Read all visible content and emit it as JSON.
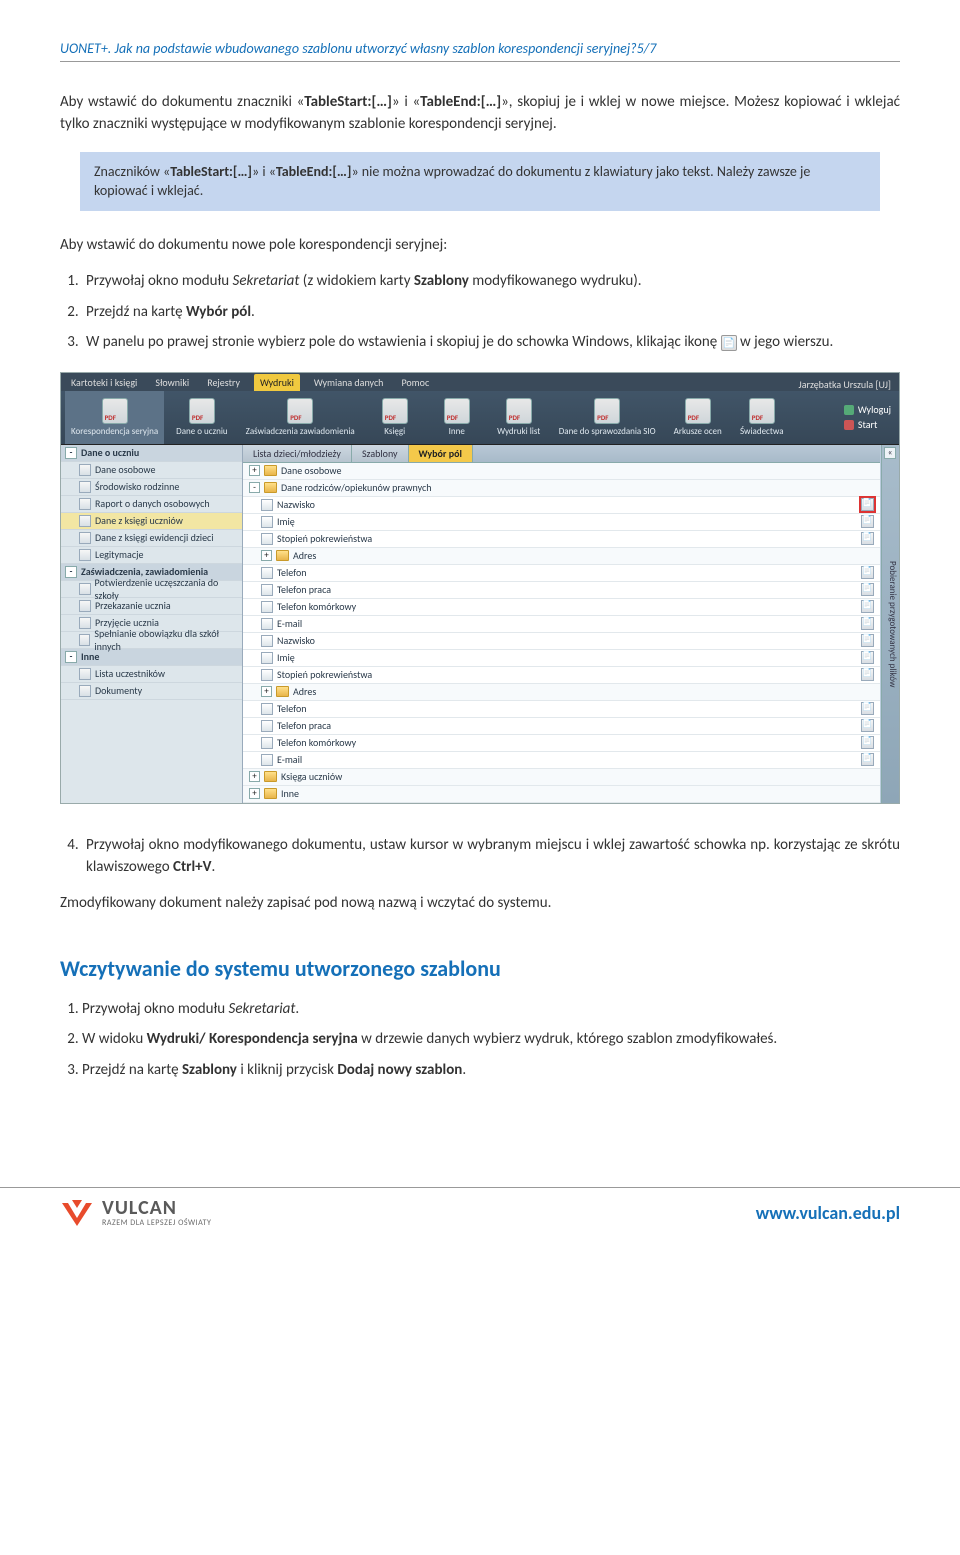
{
  "header": {
    "title": "UONET+. Jak na podstawie wbudowanego szablonu utworzyć własny szablon korespondencji seryjnej?5/7"
  },
  "para1_a": "Aby wstawić do dokumentu znaczniki «",
  "para1_ts": "TableStart:[…]",
  "para1_b": "» i «",
  "para1_te": "TableEnd:[…]",
  "para1_c": "», skopiuj je i wklej w nowe miejsce. Możesz kopiować i wklejać tylko znaczniki występujące w modyfikowanym szablonie korespondencji seryjnej.",
  "callout_a": "Znaczników «",
  "callout_ts": "TableStart:[…]",
  "callout_b": "» i «",
  "callout_te": "TableEnd:[…]",
  "callout_c": "» nie można wprowadzać do dokumentu z klawiatury jako tekst. Należy zawsze je kopiować i wklejać.",
  "para2": "Aby wstawić do dokumentu nowe pole korespondencji seryjnej:",
  "step1_a": "Przywołaj okno modułu ",
  "step1_b": "Sekretariat",
  "step1_c": " (z widokiem karty ",
  "step1_d": "Szablony",
  "step1_e": " modyfikowanego wydruku).",
  "step2_a": "Przejdź na kartę ",
  "step2_b": "Wybór pól",
  "step2_c": ".",
  "step3_a": "W panelu po prawej stronie wybierz pole do wstawienia i skopiuj je do schowka Windows, klikając ikonę ",
  "step3_b": " w jego wierszu.",
  "step4_a": "Przywołaj okno modyfikowanego dokumentu, ustaw kursor w wybranym miejscu i wklej zawartość schowka np. korzystając ze skrótu klawiszowego ",
  "step4_b": "Ctrl+V",
  "step4_c": ".",
  "para3": "Zmodyfikowany dokument należy zapisać pod nową nazwą i wczytać do systemu.",
  "section2": "Wczytywanie do systemu utworzonego szablonu",
  "s2_step1_a": "Przywołaj okno modułu ",
  "s2_step1_b": "Sekretariat",
  "s2_step1_c": ".",
  "s2_step2_a": "W widoku ",
  "s2_step2_b": "Wydruki/ Korespondencja seryjna",
  "s2_step2_c": " w drzewie danych wybierz wydruk, którego szablon zmodyfikowałeś.",
  "s2_step3_a": "Przejdź na kartę ",
  "s2_step3_b": "Szablony",
  "s2_step3_c": " i kliknij przycisk ",
  "s2_step3_d": "Dodaj nowy szablon",
  "s2_step3_e": ".",
  "app": {
    "topmenu": [
      "Kartoteki i księgi",
      "Słowniki",
      "Rejestry",
      "Wydruki",
      "Wymiana danych",
      "Pomoc"
    ],
    "user": "Jarzębatka Urszula [UJ]",
    "ribbon": [
      {
        "label": "Korespondencja seryjna",
        "active": true
      },
      {
        "label": "Dane o uczniu"
      },
      {
        "label": "Zaświadczenia zawiadomienia"
      },
      {
        "label": "Księgi"
      },
      {
        "label": "Inne"
      },
      {
        "label": "Wydruki list"
      },
      {
        "label": "Dane do sprawozdania SIO"
      },
      {
        "label": "Arkusze ocen"
      },
      {
        "label": "Świadectwa"
      }
    ],
    "rib_right": {
      "logout": "Wyloguj",
      "start": "Start"
    },
    "sidebar": [
      {
        "type": "hdr",
        "label": "Dane o uczniu",
        "toggle": "-"
      },
      {
        "type": "item",
        "label": "Dane osobowe"
      },
      {
        "type": "item",
        "label": "Środowisko rodzinne"
      },
      {
        "type": "item",
        "label": "Raport o danych osobowych"
      },
      {
        "type": "item",
        "label": "Dane z księgi uczniów",
        "sel": true
      },
      {
        "type": "item",
        "label": "Dane z księgi ewidencji dzieci"
      },
      {
        "type": "item",
        "label": "Legitymacje"
      },
      {
        "type": "hdr",
        "label": "Zaświadczenia, zawiadomienia",
        "toggle": "-"
      },
      {
        "type": "item",
        "label": "Potwierdzenie uczęszczania do szkoły"
      },
      {
        "type": "item",
        "label": "Przekazanie ucznia"
      },
      {
        "type": "item",
        "label": "Przyjęcie ucznia"
      },
      {
        "type": "item",
        "label": "Spełnianie obowiązku dla szkół innych"
      },
      {
        "type": "hdr",
        "label": "Inne",
        "toggle": "-"
      },
      {
        "type": "item",
        "label": "Lista uczestników"
      },
      {
        "type": "item",
        "label": "Dokumenty"
      }
    ],
    "tabs": [
      "Lista dzieci/młodzieży",
      "Szablony",
      "Wybór pól"
    ],
    "tree": [
      {
        "lvl": 0,
        "kind": "folder",
        "toggle": "+",
        "label": "Dane osobowe"
      },
      {
        "lvl": 0,
        "kind": "folder",
        "toggle": "-",
        "label": "Dane rodziców/opiekunów prawnych"
      },
      {
        "lvl": 1,
        "kind": "field",
        "label": "Nazwisko",
        "copy": true,
        "hl": true
      },
      {
        "lvl": 1,
        "kind": "field",
        "label": "Imię",
        "copy": true
      },
      {
        "lvl": 1,
        "kind": "field",
        "label": "Stopień pokrewieństwa",
        "copy": true
      },
      {
        "lvl": 1,
        "kind": "folder",
        "toggle": "+",
        "label": "Adres"
      },
      {
        "lvl": 1,
        "kind": "field",
        "label": "Telefon",
        "copy": true
      },
      {
        "lvl": 1,
        "kind": "field",
        "label": "Telefon praca",
        "copy": true
      },
      {
        "lvl": 1,
        "kind": "field",
        "label": "Telefon komórkowy",
        "copy": true
      },
      {
        "lvl": 1,
        "kind": "field",
        "label": "E-mail",
        "copy": true
      },
      {
        "lvl": 1,
        "kind": "field",
        "label": "Nazwisko",
        "copy": true
      },
      {
        "lvl": 1,
        "kind": "field",
        "label": "Imię",
        "copy": true
      },
      {
        "lvl": 1,
        "kind": "field",
        "label": "Stopień pokrewieństwa",
        "copy": true
      },
      {
        "lvl": 1,
        "kind": "folder",
        "toggle": "+",
        "label": "Adres"
      },
      {
        "lvl": 1,
        "kind": "field",
        "label": "Telefon",
        "copy": true
      },
      {
        "lvl": 1,
        "kind": "field",
        "label": "Telefon praca",
        "copy": true
      },
      {
        "lvl": 1,
        "kind": "field",
        "label": "Telefon komórkowy",
        "copy": true
      },
      {
        "lvl": 1,
        "kind": "field",
        "label": "E-mail",
        "copy": true
      },
      {
        "lvl": 0,
        "kind": "folder",
        "toggle": "+",
        "label": "Księga uczniów"
      },
      {
        "lvl": 0,
        "kind": "folder",
        "toggle": "+",
        "label": "Inne"
      }
    ],
    "sidestrip": "Pobieranie przygotowanych plików"
  },
  "footer": {
    "brand": "VULCAN",
    "tagline": "RAZEM DLA LEPSZEJ OŚWIATY",
    "url": "www.vulcan.edu.pl"
  }
}
